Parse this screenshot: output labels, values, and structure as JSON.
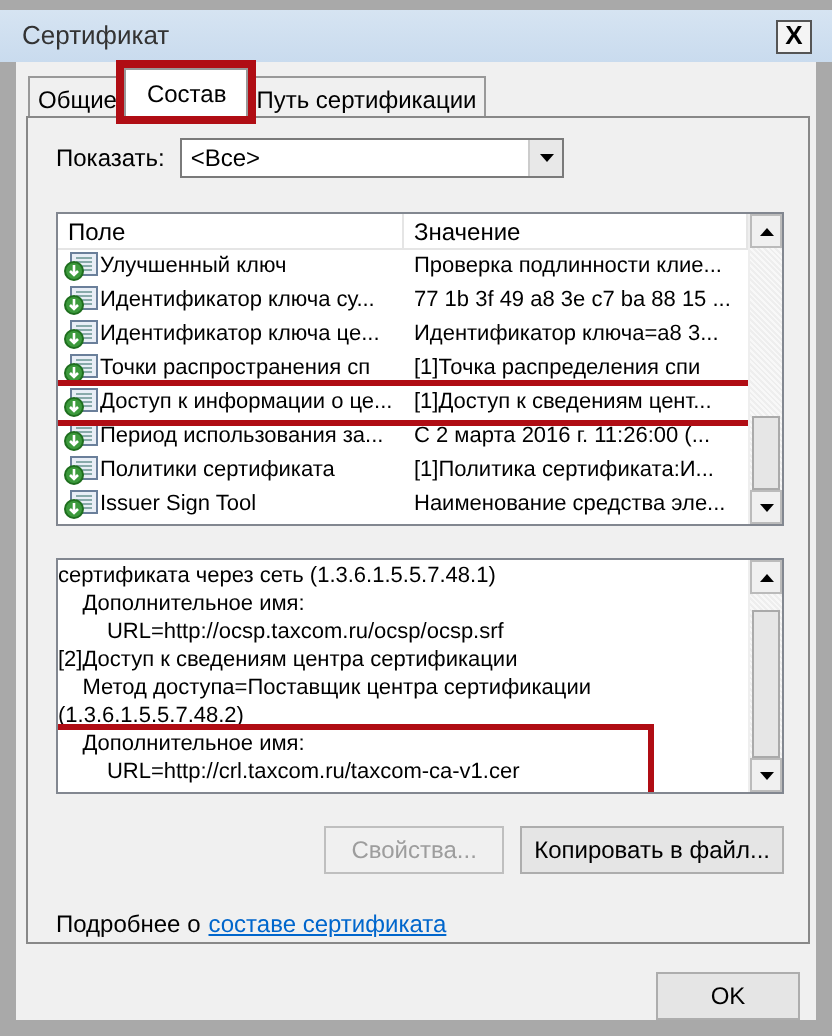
{
  "window": {
    "title": "Сертификат",
    "close": "X"
  },
  "tabs": [
    {
      "label": "Общие",
      "selected": false,
      "highlighted": false
    },
    {
      "label": "Состав",
      "selected": true,
      "highlighted": true
    },
    {
      "label": "Путь сертификации",
      "selected": false,
      "highlighted": false
    }
  ],
  "show": {
    "label": "Показать:",
    "value": "<Все>"
  },
  "fields": {
    "columns": [
      "Поле",
      "Значение"
    ],
    "rows": [
      {
        "field": "Улучшенный ключ",
        "value": "Проверка подлинности клие...",
        "highlighted": false
      },
      {
        "field": "Идентификатор ключа су...",
        "value": "77 1b 3f 49 a8 3e c7 ba 88 15 ...",
        "highlighted": false
      },
      {
        "field": "Идентификатор ключа це...",
        "value": "Идентификатор ключа=a8 3...",
        "highlighted": false
      },
      {
        "field": "Точки распространения сп",
        "value": "[1]Точка распределения спи",
        "highlighted": false
      },
      {
        "field": "Доступ к информации о це...",
        "value": "[1]Доступ к сведениям цент...",
        "highlighted": true
      },
      {
        "field": "Период использования за...",
        "value": "С 2 марта 2016 г. 11:26:00 (...",
        "highlighted": false
      },
      {
        "field": "Политики сертификата",
        "value": "[1]Политика сертификата:И...",
        "highlighted": false
      },
      {
        "field": "Issuer Sign Tool",
        "value": "Наименование средства эле...",
        "highlighted": false
      }
    ]
  },
  "details": [
    {
      "text": "сертификата через сеть (1.3.6.1.5.5.7.48.1)",
      "highlighted": false
    },
    {
      "text": "    Дополнительное имя:",
      "highlighted": false
    },
    {
      "text": "        URL=http://ocsp.taxcom.ru/ocsp/ocsp.srf",
      "highlighted": false
    },
    {
      "text": "[2]Доступ к сведениям центра сертификации",
      "highlighted": false
    },
    {
      "text": "    Метод доступа=Поставщик центра сертификации",
      "highlighted": false
    },
    {
      "text": "(1.3.6.1.5.5.7.48.2)",
      "highlighted": false
    },
    {
      "text": "    Дополнительное имя:",
      "highlighted": true
    },
    {
      "text": "        URL=http://crl.taxcom.ru/taxcom-ca-v1.cer",
      "highlighted": true
    }
  ],
  "buttons": [
    {
      "label": "Свойства...",
      "disabled": true
    },
    {
      "label": "Копировать в файл...",
      "disabled": false
    }
  ],
  "more": {
    "text": "Подробнее о",
    "link": "составе сертификата"
  },
  "ok": "OK"
}
